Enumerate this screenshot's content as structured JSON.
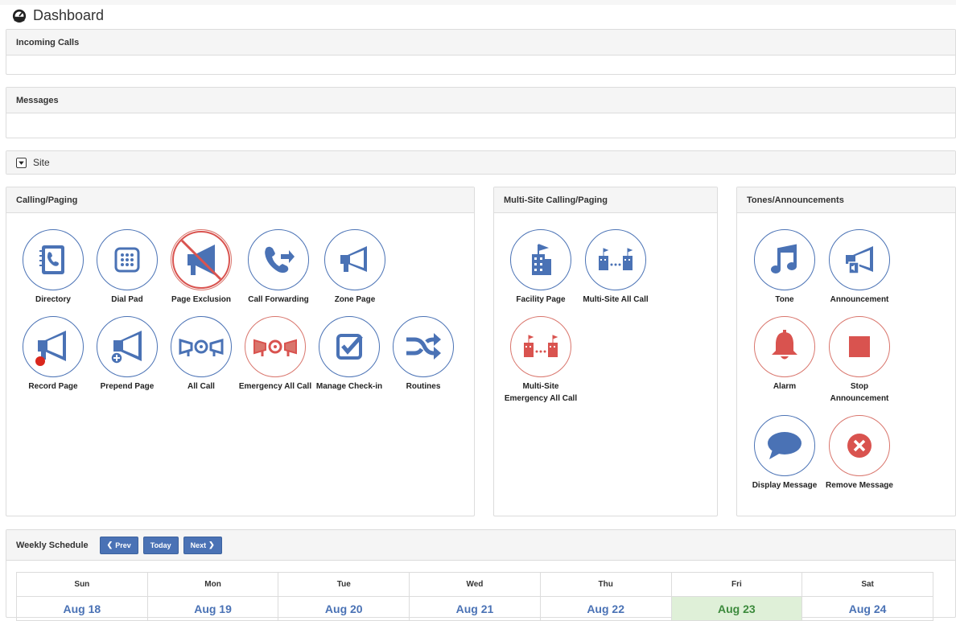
{
  "page": {
    "title": "Dashboard",
    "icon": "dashboard-icon"
  },
  "incoming_calls": {
    "title": "Incoming Calls"
  },
  "messages": {
    "title": "Messages"
  },
  "site": {
    "label": "Site",
    "icon": "collapse-toggle-icon"
  },
  "calling_paging": {
    "title": "Calling/Paging",
    "tiles": [
      {
        "label": "Directory",
        "icon": "directory-icon"
      },
      {
        "label": "Dial Pad",
        "icon": "dial-pad-icon"
      },
      {
        "label": "Page Exclusion",
        "icon": "page-exclusion-icon"
      },
      {
        "label": "Call Forwarding",
        "icon": "call-forwarding-icon"
      },
      {
        "label": "Zone Page",
        "icon": "megaphone-icon"
      },
      {
        "label": "Record Page",
        "icon": "record-page-icon"
      },
      {
        "label": "Prepend Page",
        "icon": "prepend-page-icon"
      },
      {
        "label": "All Call",
        "icon": "all-call-icon"
      },
      {
        "label": "Emergency All Call",
        "icon": "emergency-all-call-icon"
      },
      {
        "label": "Manage Check-in",
        "icon": "check-in-icon"
      },
      {
        "label": "Routines",
        "icon": "shuffle-icon"
      }
    ]
  },
  "multi_site": {
    "title": "Multi-Site Calling/Paging",
    "tiles": [
      {
        "label": "Facility Page",
        "icon": "facility-icon"
      },
      {
        "label": "Multi-Site All Call",
        "icon": "multi-site-icon"
      },
      {
        "label": "Multi-Site Emergency All Call",
        "icon": "multi-site-emergency-icon"
      }
    ]
  },
  "tones": {
    "title": "Tones/Announcements",
    "tiles": [
      {
        "label": "Tone",
        "icon": "music-note-icon"
      },
      {
        "label": "Announcement",
        "icon": "announcement-icon"
      },
      {
        "label": "Alarm",
        "icon": "bell-icon"
      },
      {
        "label": "Stop Announcement",
        "icon": "stop-icon"
      },
      {
        "label": "Display Message",
        "icon": "speech-bubble-icon"
      },
      {
        "label": "Remove Message",
        "icon": "remove-circle-icon"
      }
    ]
  },
  "schedule": {
    "title": "Weekly Schedule",
    "prev": "Prev",
    "today": "Today",
    "next": "Next",
    "days": [
      "Sun",
      "Mon",
      "Tue",
      "Wed",
      "Thu",
      "Fri",
      "Sat"
    ],
    "dates": [
      "Aug 18",
      "Aug 19",
      "Aug 20",
      "Aug 21",
      "Aug 22",
      "Aug 23",
      "Aug 24"
    ],
    "highlight_day": "Fri"
  },
  "colors": {
    "accent": "#4a72b5",
    "alert": "#d9534f",
    "today_bg": "#dff0d8"
  }
}
